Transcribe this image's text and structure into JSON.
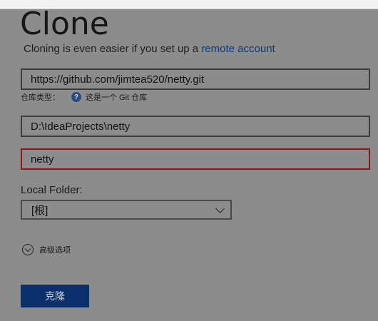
{
  "dialog": {
    "title": "Clone",
    "subtitle_text": "Cloning is even easier if you set up a ",
    "subtitle_link": "remote account"
  },
  "fields": {
    "url_value": "https://github.com/jimtea520/netty.git",
    "repo_type_label": "仓库类型：",
    "repo_type_value": "这是一个 Git 仓库",
    "path_value": "D:\\IdeaProjects\\netty",
    "name_value": "netty"
  },
  "local_folder": {
    "label": "Local Folder:",
    "selected": "[根]"
  },
  "advanced": {
    "label": "高级选项"
  },
  "actions": {
    "clone_label": "克隆"
  },
  "icons": {
    "help": "help-circle-icon",
    "dropdown": "chevron-down-icon",
    "expand": "circle-chevron-down-icon"
  }
}
